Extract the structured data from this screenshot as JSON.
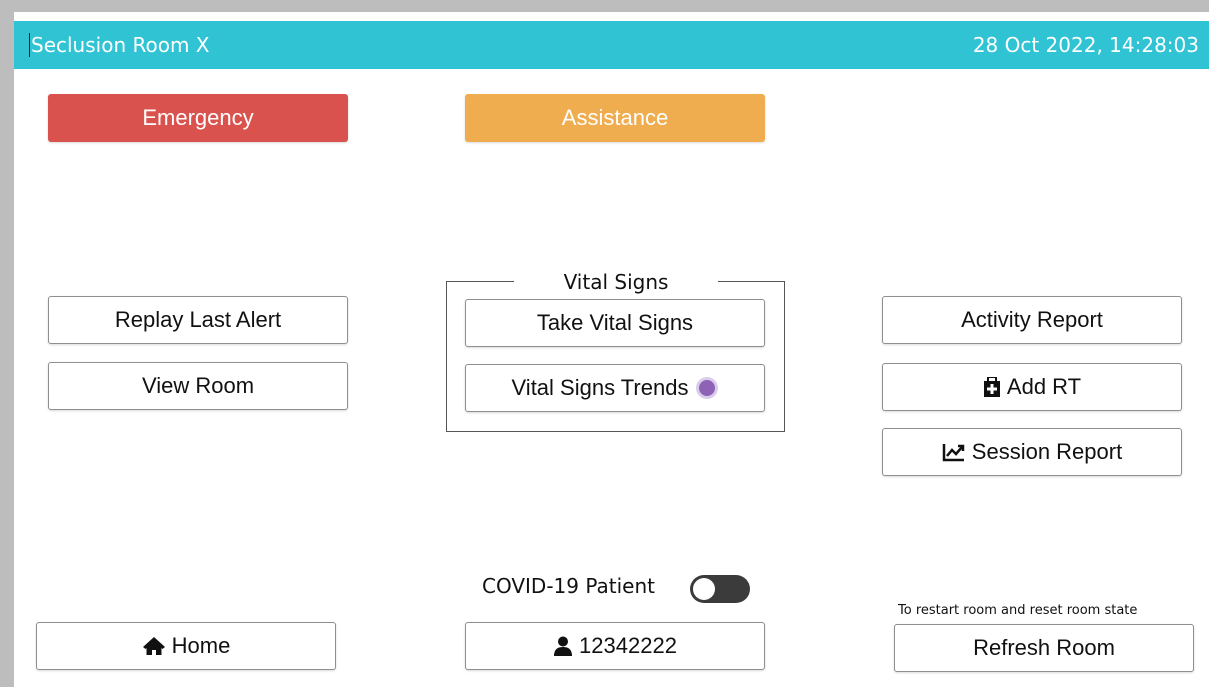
{
  "header": {
    "room_title": "Seclusion Room X",
    "datetime": "28 Oct 2022, 14:28:03"
  },
  "alerts": {
    "emergency_label": "Emergency",
    "assistance_label": "Assistance"
  },
  "left_actions": {
    "replay_label": "Replay Last Alert",
    "view_room_label": "View Room"
  },
  "vital_signs": {
    "legend": "Vital Signs",
    "take_label": "Take Vital Signs",
    "trends_label": "Vital Signs Trends"
  },
  "right_actions": {
    "activity_label": "Activity Report",
    "add_rt_label": "Add RT",
    "session_label": "Session Report"
  },
  "footer": {
    "covid_label": "COVID-19 Patient",
    "home_label": "Home",
    "patient_id": "12342222",
    "refresh_hint": "To restart room and reset room state",
    "refresh_label": "Refresh Room"
  },
  "colors": {
    "header_bg": "#2fc3d4",
    "emergency": "#da524d",
    "assistance": "#efad4f",
    "trend_indicator": "#8e62b5",
    "toggle_off": "#3b3b3b"
  },
  "icons": [
    "home-icon",
    "user-icon",
    "medkit-icon",
    "line-chart-icon"
  ]
}
